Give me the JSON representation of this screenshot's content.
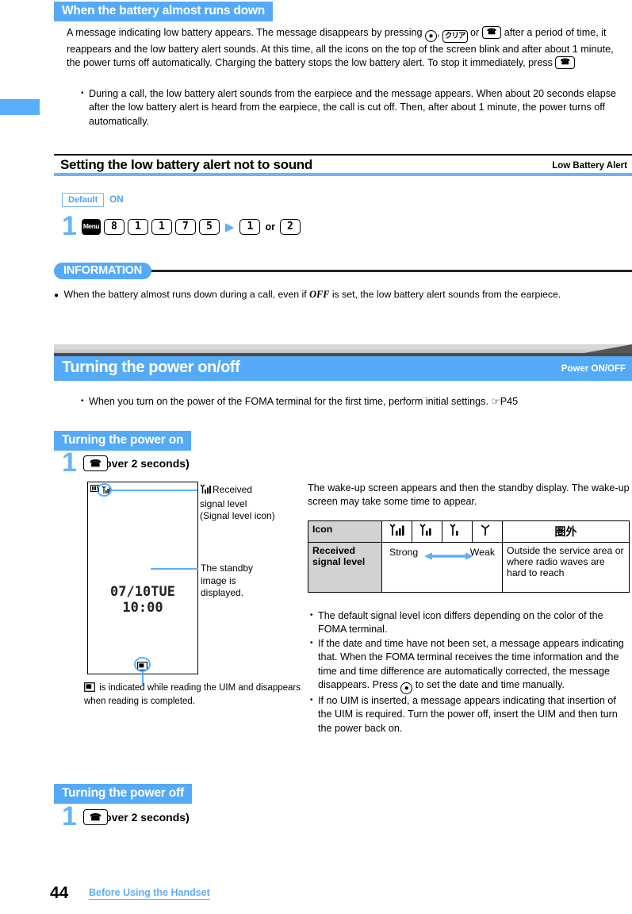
{
  "page": {
    "number": "44",
    "chapter_footer": "Before Using the Handset"
  },
  "section_low_battery": {
    "heading": "When the battery almost runs down",
    "paragraph_part1": "A message indicating low battery appears. The message disappears by pressing ",
    "paragraph_part2": ", ",
    "paragraph_part3": " or ",
    "paragraph_part4": ", but after a period of time, it reappears and the low battery alert sounds. At this time, all the icons on the top of the screen blink and after about 1 minute, the power turns off automatically. Charging the battery stops the low battery alert. To stop it immediately, press ",
    "paragraph_part5": ".",
    "keys": {
      "select": "▼",
      "clear": "クリア",
      "power": "☎"
    },
    "bullet": "During a call, the low battery alert sounds from the earpiece and the message appears.  When about 20 seconds elapse after the low battery alert is heard from the earpiece, the call is cut off. Then, after about 1 minute, the power turns off automatically."
  },
  "setting_header": {
    "title": "Setting the low battery alert not to sound",
    "right_label": "Low Battery Alert"
  },
  "default_setting": {
    "label": "Default",
    "value": "ON"
  },
  "operation_step": {
    "number": "1",
    "keys": [
      "Menu",
      "8",
      "1",
      "1",
      "7",
      "5"
    ],
    "arrow": "▶",
    "result_keys": [
      "1",
      "2"
    ],
    "or_label": "or"
  },
  "information": {
    "label": "INFORMATION",
    "items": [
      {
        "before": "When the battery almost runs down during a call, even if ",
        "emphasis": "OFF",
        "after": " is set, the low battery alert sounds from the earpiece."
      }
    ]
  },
  "chapter_header": {
    "title": "Turning the power on/off",
    "right_label": "Power ON/OFF"
  },
  "intro_bullet": "When you turn on the power of the FOMA terminal for the first time, perform initial settings. ☞P45",
  "power_on": {
    "heading": "Turning the power on",
    "step_number": "1",
    "step_key": "☎",
    "step_text": "(for over 2 seconds)"
  },
  "phone_illustration": {
    "clock": "07/10TUE 10:00",
    "callout_signal": "Received signal level (Signal level icon)",
    "callout_signal_line1": "Received",
    "callout_signal_line2": "signal level",
    "callout_signal_line3": "(Signal level icon)",
    "callout_standby_line1": "The standby",
    "callout_standby_line2": "image is",
    "callout_standby_line3": "displayed.",
    "caption_line1": " is indicated while reading the UIM and",
    "caption_line2": "disappears when reading is completed."
  },
  "right_column": {
    "intro": "The wake-up screen appears and then the standby display. The wake-up screen may take some time to appear.",
    "bullets": [
      "The default signal level icon differs depending on the color of the FOMA terminal.",
      "If the date and time have not been set, a message appears indicating that. When the FOMA terminal receives the time information and the time and time difference are automatically corrected, the message disappears. Press  to set the date and time manually.",
      "If no UIM is inserted, a message appears indicating that insertion of the UIM is required. Turn the power off, insert the UIM and then turn the power back on."
    ],
    "bullet2_before": "If the date and time have not been set, a message appears indicating that. When the FOMA terminal receives the time information and the time and time difference are automatically corrected, the message disappears. Press ",
    "bullet2_after": " to set the date and time manually."
  },
  "signal_table": {
    "header_label": "Icon",
    "row_label_line1": "Received",
    "row_label_line2": "signal level",
    "icons": [
      "3-bar-antenna",
      "2-bar-antenna",
      "1-bar-antenna",
      "0-bar-antenna"
    ],
    "out_of_area_icon": "圏外",
    "strong_label": "Strong",
    "weak_label": "Weak",
    "out_of_area_text": "Outside the service area or where radio waves are hard to reach"
  },
  "power_off": {
    "heading": "Turning the power off",
    "step_number": "1",
    "step_key": "☎",
    "step_text": "(for over 2 seconds)"
  },
  "colors": {
    "accent_blue": "#55aaf8",
    "header_gray": "#d2d2d2"
  }
}
